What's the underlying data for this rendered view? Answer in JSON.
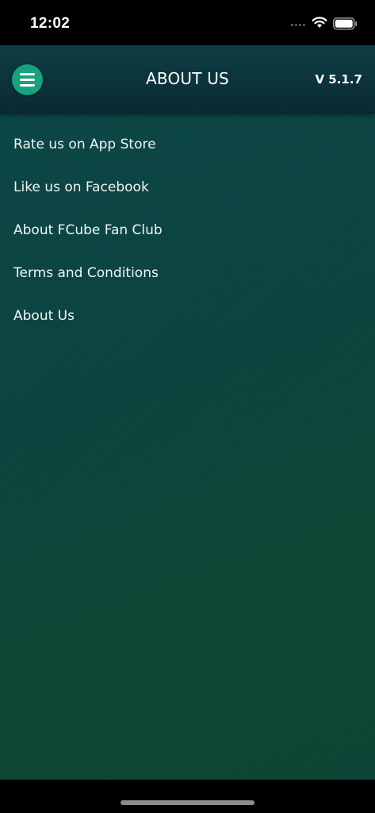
{
  "status_bar": {
    "time": "12:02",
    "icons": [
      "cellular-signal-icon",
      "wifi-icon",
      "battery-icon"
    ]
  },
  "header": {
    "title": "ABOUT US",
    "version": "V 5.1.7",
    "menu_icon": "hamburger-menu-icon"
  },
  "menu": {
    "items": [
      {
        "label": "Rate us on App Store"
      },
      {
        "label": "Like us on Facebook"
      },
      {
        "label": "About FCube Fan Club"
      },
      {
        "label": "Terms and Conditions"
      },
      {
        "label": "About Us"
      }
    ]
  },
  "colors": {
    "accent": "#17a37d",
    "header_background": "#0b3239",
    "content_background_top": "#0c4848",
    "content_background_bottom": "#0e4a35",
    "text": "#ffffff"
  }
}
